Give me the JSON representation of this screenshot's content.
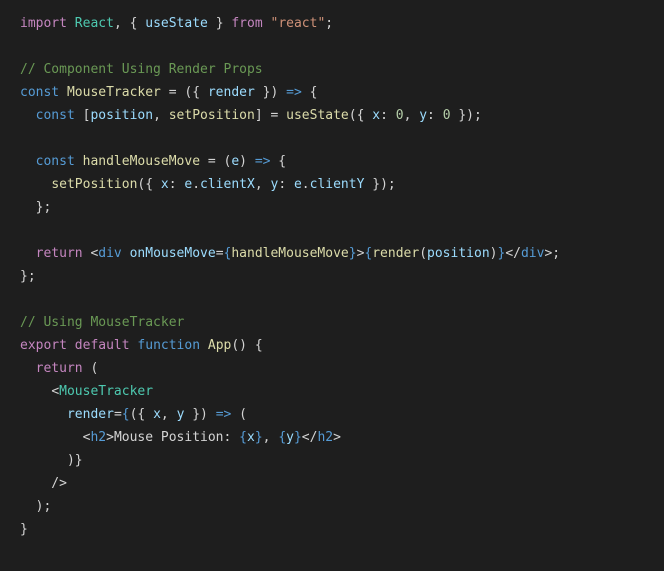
{
  "l1": {
    "imp": "import",
    "react": "React",
    "comma": ", { ",
    "us": "useState",
    "close": " } ",
    "from": "from",
    "sp": " ",
    "str": "\"react\"",
    "semi": ";"
  },
  "l3": {
    "cmt": "// Component Using Render Props"
  },
  "l4": {
    "kconst": "const",
    "sp1": " ",
    "mt": "MouseTracker",
    "sp2": " = ({ ",
    "render": "render",
    "close": " }) ",
    "arrow": "=>",
    "brace": " {"
  },
  "l5": {
    "ind": "  ",
    "kconst": "const",
    "sp1": " [",
    "pos": "position",
    "c1": ", ",
    "setp": "setPosition",
    "c2": "] = ",
    "use": "useState",
    "op": "({ ",
    "x": "x",
    "col1": ": ",
    "n1": "0",
    "cm": ", ",
    "y": "y",
    "col2": ": ",
    "n2": "0",
    "cl": " });"
  },
  "l7": {
    "ind": "  ",
    "kconst": "const",
    "sp": " ",
    "h": "handleMouseMove",
    "eq": " = (",
    "e": "e",
    "cl": ") ",
    "ar": "=>",
    "br": " {"
  },
  "l8": {
    "ind": "    ",
    "sp": "setPosition",
    "op": "({ ",
    "x": "x",
    "c1": ": ",
    "e1": "e",
    "dot1": ".",
    "cx": "clientX",
    "cm": ", ",
    "y": "y",
    "c2": ": ",
    "e2": "e",
    "dot2": ".",
    "cy": "clientY",
    "cl": " });"
  },
  "l9": {
    "txt": "  };"
  },
  "l11": {
    "ind": "  ",
    "ret": "return",
    "sp": " ",
    "lt": "<",
    "div": "div",
    "sp2": " ",
    "attr": "onMouseMove",
    "eq": "=",
    "ob": "{",
    "hm": "handleMouseMove",
    "cb": "}",
    "gt": ">",
    "ob2": "{",
    "ren": "render",
    "op": "(",
    "pos": "position",
    "cp": ")",
    "cb2": "}",
    "lt2": "</",
    "div2": "div",
    "gt2": ">",
    ";": ";"
  },
  "l12": {
    "txt": "};"
  },
  "l14": {
    "cmt": "// Using MouseTracker"
  },
  "l15": {
    "exp": "export",
    "sp": " ",
    "def": "default",
    "sp2": " ",
    "fn": "function",
    "sp3": " ",
    "app": "App",
    "par": "() {"
  },
  "l16": {
    "ind": "  ",
    "ret": "return",
    "sp": " ("
  },
  "l17": {
    "ind": "    ",
    "lt": "<",
    "mt": "MouseTracker"
  },
  "l18": {
    "ind": "      ",
    "ren": "render",
    "eq": "=",
    "ob": "{",
    "par": "({ ",
    "x": "x",
    "cm": ", ",
    "y": "y",
    "cl": " }) ",
    "ar": "=>",
    "sp": " ("
  },
  "l19": {
    "ind": "        ",
    "lt": "<",
    "h2": "h2",
    "gt": ">",
    "txt": "Mouse Position: ",
    "ob1": "{",
    "x": "x",
    "cb1": "}",
    "cm": ", ",
    "ob2": "{",
    "y": "y",
    "cb2": "}",
    "lt2": "</",
    "h22": "h2",
    "gt2": ">"
  },
  "l20": {
    "txt": "      )}"
  },
  "l21": {
    "txt": "    />"
  },
  "l22": {
    "txt": "  );"
  },
  "l23": {
    "txt": "}"
  }
}
